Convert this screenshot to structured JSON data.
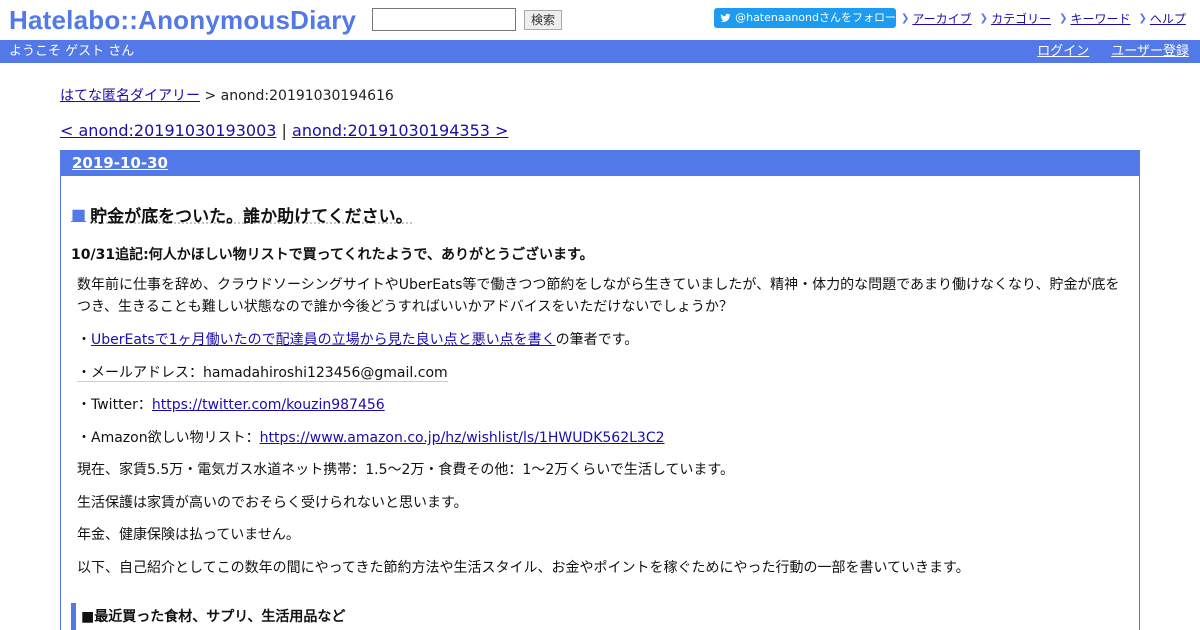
{
  "header": {
    "logo": "Hatelabo::AnonymousDiary",
    "search": {
      "placeholder": "",
      "value": "",
      "button_label": "検索"
    },
    "follow_label": "@hatenaanondさんをフォロー",
    "links": [
      "アーカイブ",
      "カテゴリー",
      "キーワード",
      "ヘルプ"
    ]
  },
  "userbar": {
    "welcome": "ようこそ ゲスト さん",
    "login": "ログイン",
    "register": "ユーザー登録"
  },
  "breadcrumb": {
    "home": "はてな匿名ダイアリー",
    "separator": ">",
    "current": "anond:20191030194616"
  },
  "pager": {
    "prev": "< anond:20191030193003",
    "separator": "|",
    "next": "anond:20191030194353 >"
  },
  "day": {
    "date": "2019-10-30",
    "entry": {
      "marker": "■",
      "title": "貯金が底をついた。誰か助けてください。",
      "lead": "10/31追記:何人かほしい物リストで買ってくれたようで、ありがとうございます。",
      "p1": "数年前に仕事を辞め、クラウドソーシングサイトやUberEats等で働きつつ節約をしながら生きていましたが、精神・体力的な問題であまり働けなくなり、貯金が底をつき、生きることも難しい状態なので誰か今後どうすればいいかアドバイスをいただけないでしょうか？",
      "item1_link": "UberEatsで1ヶ月働いたので配達員の立場から見た良い点と悪い点を書く",
      "item1_suffix": "の筆者です。",
      "item2_label": "・メールアドレス：",
      "item2_value": "hamadahiroshi123456@gmail.com",
      "item3_label": "・Twitter：",
      "item3_link": "https://twitter.com/kouzin987456",
      "item4_label": "・Amazon欲しい物リスト：",
      "item4_link": "https://www.amazon.co.jp/hz/wishlist/ls/1HWUDK562L3C2",
      "p2": "現在、家賃5.5万・電気ガス水道ネット携帯：1.5～2万・食費その他：1～2万くらいで生活しています。",
      "p3": "生活保護は家賃が高いのでおそらく受けられないと思います。",
      "p4": "年金、健康保険は払っていません。",
      "p5": "以下、自己紹介としてこの数年の間にやってきた節約方法や生活スタイル、お金やポイントを稼ぐためにやった行動の一部を書いていきます。",
      "section_head": "■最近買った食材、サプリ、生活用品など",
      "bullet": "・"
    }
  }
}
